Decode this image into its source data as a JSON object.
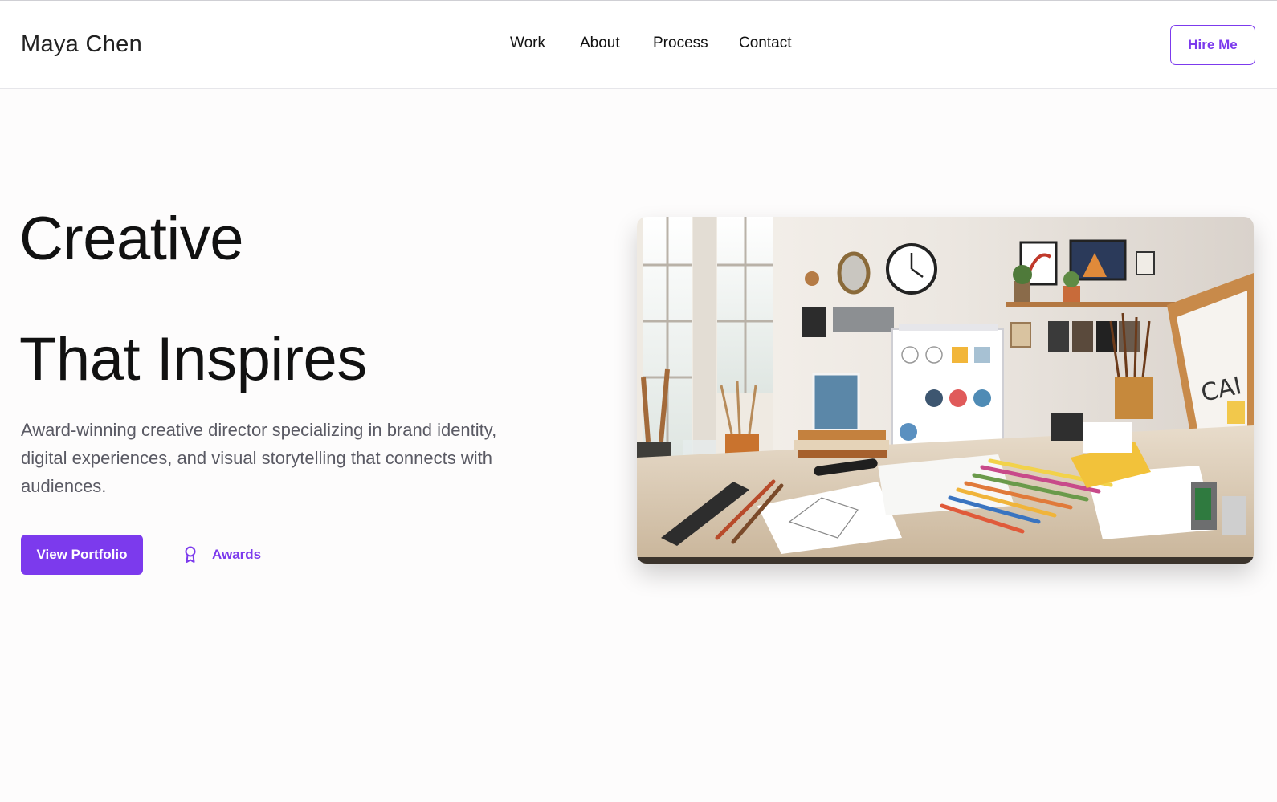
{
  "header": {
    "brand": "Maya Chen",
    "nav": [
      {
        "label": "Work"
      },
      {
        "label": "About"
      },
      {
        "label": "Process"
      },
      {
        "label": "Contact"
      }
    ],
    "cta_label": "Hire Me"
  },
  "hero": {
    "title_line1": "Creative",
    "title_line2": "That Inspires",
    "description": "Award-winning creative director specializing in brand identity, digital experiences, and visual storytelling that connects with audiences.",
    "primary_button": "View Portfolio",
    "secondary_button": "Awards",
    "secondary_icon": "award-icon",
    "image_subject": "artist-studio-desk"
  },
  "colors": {
    "accent": "#7c3aed",
    "text": "#111111",
    "muted_text": "#5a5a64",
    "background": "#fdfcfc"
  }
}
